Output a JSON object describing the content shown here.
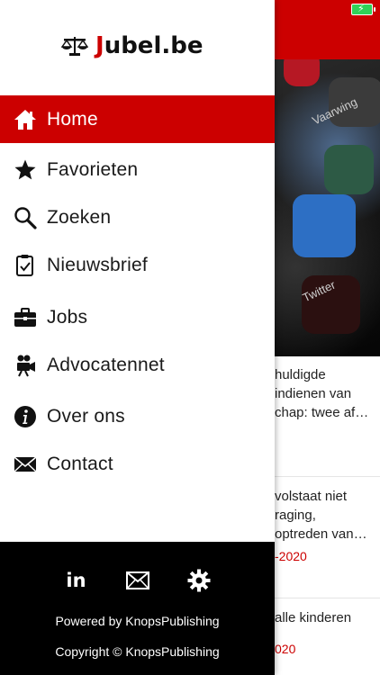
{
  "app": {
    "logo_part1": "J",
    "logo_part2": "ubel.be",
    "accent": "#cc0000"
  },
  "menu": [
    {
      "label": "Home",
      "icon": "home-icon",
      "active": true
    },
    {
      "label": "Favorieten",
      "icon": "star-icon"
    },
    {
      "label": "Zoeken",
      "icon": "search-icon"
    },
    {
      "label": "Nieuwsbrief",
      "icon": "clipboard-check-icon"
    },
    {
      "label": "Jobs",
      "icon": "briefcase-icon"
    },
    {
      "label": "Advocatennet",
      "icon": "video-camera-icon"
    },
    {
      "label": "Over ons",
      "icon": "info-icon"
    },
    {
      "label": "Contact",
      "icon": "envelope-icon"
    }
  ],
  "footer": {
    "social": [
      "linkedin-icon",
      "mail-icon",
      "gear-icon"
    ],
    "linkedin_text": "in",
    "powered": "Powered by KnopsPublishing",
    "copyright": "Copyright © KnopsPublishing"
  },
  "background": {
    "photo_text_1": "Vaarwing",
    "photo_text_2": "Twitter",
    "articles": [
      {
        "lines": [
          "huldigde",
          " indienen van",
          "chap: twee af…"
        ],
        "date": ""
      },
      {
        "lines": [
          "volstaat niet",
          "raging,",
          "optreden van…"
        ],
        "date": "-2020"
      },
      {
        "lines": [
          "alle kinderen"
        ],
        "date": "020"
      }
    ]
  }
}
